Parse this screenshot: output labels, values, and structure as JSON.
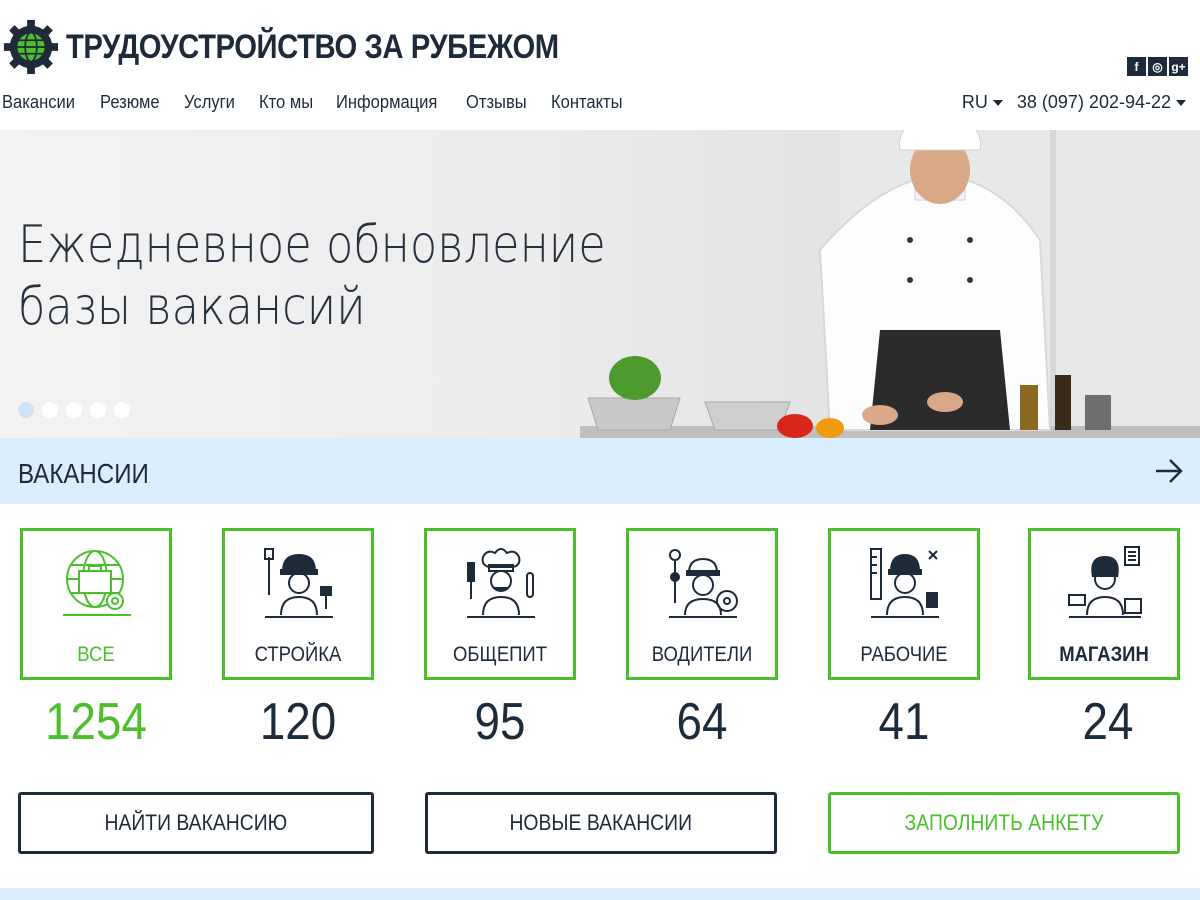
{
  "brand": {
    "name": "ТРУДОУСТРОЙСТВО ЗА РУБЕЖОМ"
  },
  "social": {
    "fb": "f",
    "ig": "◎",
    "gp": "g+"
  },
  "nav": {
    "items": [
      "Вакансии",
      "Резюме",
      "Услуги",
      "Кто мы",
      "Информация",
      "Отзывы",
      "Контакты"
    ],
    "lang": "RU",
    "phone": "38 (097) 202-94-22"
  },
  "hero": {
    "line1": "Ежедневное обновление",
    "line2": "базы вакансий",
    "slides": 5,
    "active_slide": 1
  },
  "section": {
    "title": "ВАКАНСИИ"
  },
  "categories": [
    {
      "label": "ВСЕ",
      "count": "1254",
      "icon": "globe-briefcase-icon"
    },
    {
      "label": "СТРОЙКА",
      "count": "120",
      "icon": "builder-icon"
    },
    {
      "label": "ОБЩЕПИТ",
      "count": "95",
      "icon": "chef-icon"
    },
    {
      "label": "ВОДИТЕЛИ",
      "count": "64",
      "icon": "driver-icon"
    },
    {
      "label": "РАБОЧИЕ",
      "count": "41",
      "icon": "worker-icon"
    },
    {
      "label": "МАГАЗИН",
      "count": "24",
      "icon": "shop-assistant-icon"
    }
  ],
  "buttons": {
    "find": "НАЙТИ ВАКАНСИЮ",
    "new": "НОВЫЕ ВАКАНСИИ",
    "form": "ЗАПОЛНИТЬ АНКЕТУ"
  },
  "colors": {
    "accent": "#4cbf2d",
    "dark": "#1d2a3a",
    "light_blue": "#daeeff"
  }
}
